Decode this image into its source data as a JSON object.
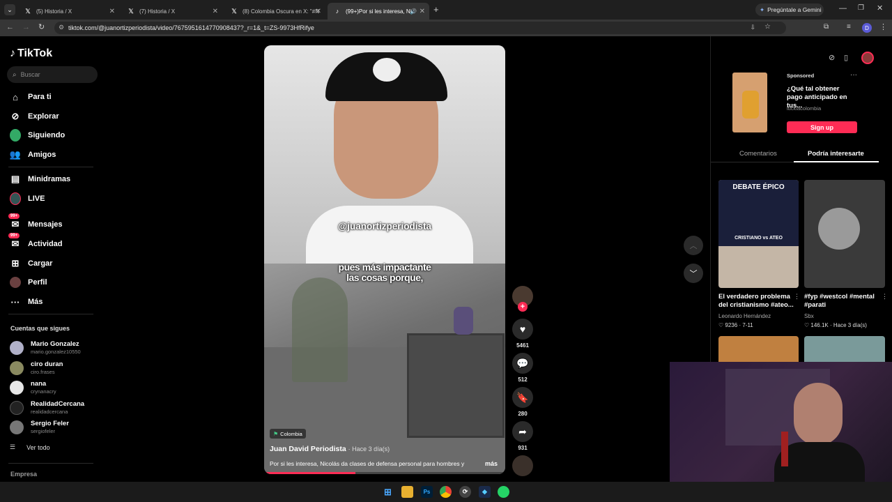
{
  "browser": {
    "tabs": [
      {
        "label": "(5) Historia / X",
        "icon": "x-logo-icon"
      },
      {
        "label": "(7) Historia / X",
        "icon": "x-logo-icon"
      },
      {
        "label": "(8) Colombia Oscura en X: \"#N",
        "icon": "x-logo-icon"
      },
      {
        "label": "(99+)Por si les interesa, Nic",
        "icon": "tiktok-icon"
      }
    ],
    "url": "tiktok.com/@juanortizperiodista/video/7675951614770908437?_r=1&_t=ZS-9973HfRifye",
    "gemini_button": "Pregúntale a Gemini"
  },
  "sidebar": {
    "logo": "TikTok",
    "search_placeholder": "Buscar",
    "nav": [
      {
        "label": "Para ti",
        "icon": "home-icon"
      },
      {
        "label": "Explorar",
        "icon": "compass-icon"
      },
      {
        "label": "Siguiendo",
        "icon": "following-icon"
      },
      {
        "label": "Amigos",
        "icon": "friends-icon"
      },
      {
        "label": "Minidramas",
        "icon": "minidramas-icon"
      },
      {
        "label": "LIVE",
        "icon": "live-icon"
      },
      {
        "label": "Mensajes",
        "icon": "messages-icon",
        "badge": "99+"
      },
      {
        "label": "Actividad",
        "icon": "activity-icon",
        "badge": "99+"
      },
      {
        "label": "Cargar",
        "icon": "upload-icon"
      },
      {
        "label": "Perfil",
        "icon": "profile-icon"
      },
      {
        "label": "Más",
        "icon": "more-icon"
      }
    ],
    "following_title": "Cuentas que sigues",
    "following": [
      {
        "name": "Mario Gonzalez",
        "handle": "mario.gonzalez10550"
      },
      {
        "name": "ciro duran",
        "handle": "ciro.frases"
      },
      {
        "name": "nana",
        "handle": "crynanacry"
      },
      {
        "name": "RealidadCercana",
        "handle": "realidadcercana"
      },
      {
        "name": "Sergio Feler",
        "handle": "sergiofeler"
      }
    ],
    "see_all": "Ver todo",
    "footer": "Empresa"
  },
  "video": {
    "watermark": "@juanortizperiodista",
    "caption_line1": "pues más impactante",
    "caption_line2": "las cosas porque,",
    "location": "Colombia",
    "author": "Juan David Periodista",
    "time": "· Hace 3 día(s)",
    "description": "Por si les interesa, Nicolás da clases de defensa personal para hombres y",
    "more": "más",
    "likes": "5461",
    "comments": "512",
    "saves": "280",
    "shares": "931"
  },
  "right": {
    "ad": {
      "sponsored": "Sponsored",
      "title": "¿Qué tal obtener pago anticipado en tus...",
      "brand": "luckiacolombia",
      "cta": "Sign up"
    },
    "tabs": [
      "Comentarios",
      "Podría interesarte"
    ],
    "cards": [
      {
        "thumb_title": "DEBATE ÉPICO",
        "thumb_sub": "CRISTIANO vs ATEO",
        "title": "El verdadero problema del cristianismo #ateo...",
        "author": "Leonardo Hernández",
        "likes": "9236",
        "date": "· 7-11"
      },
      {
        "title": "#fyp #westcol #mental #parati",
        "author": "Sbx",
        "likes": "146.1K",
        "date": "· Hace 3 día(s)"
      }
    ]
  },
  "colors": {
    "accent": "#fe2c55",
    "bg": "#000000"
  }
}
